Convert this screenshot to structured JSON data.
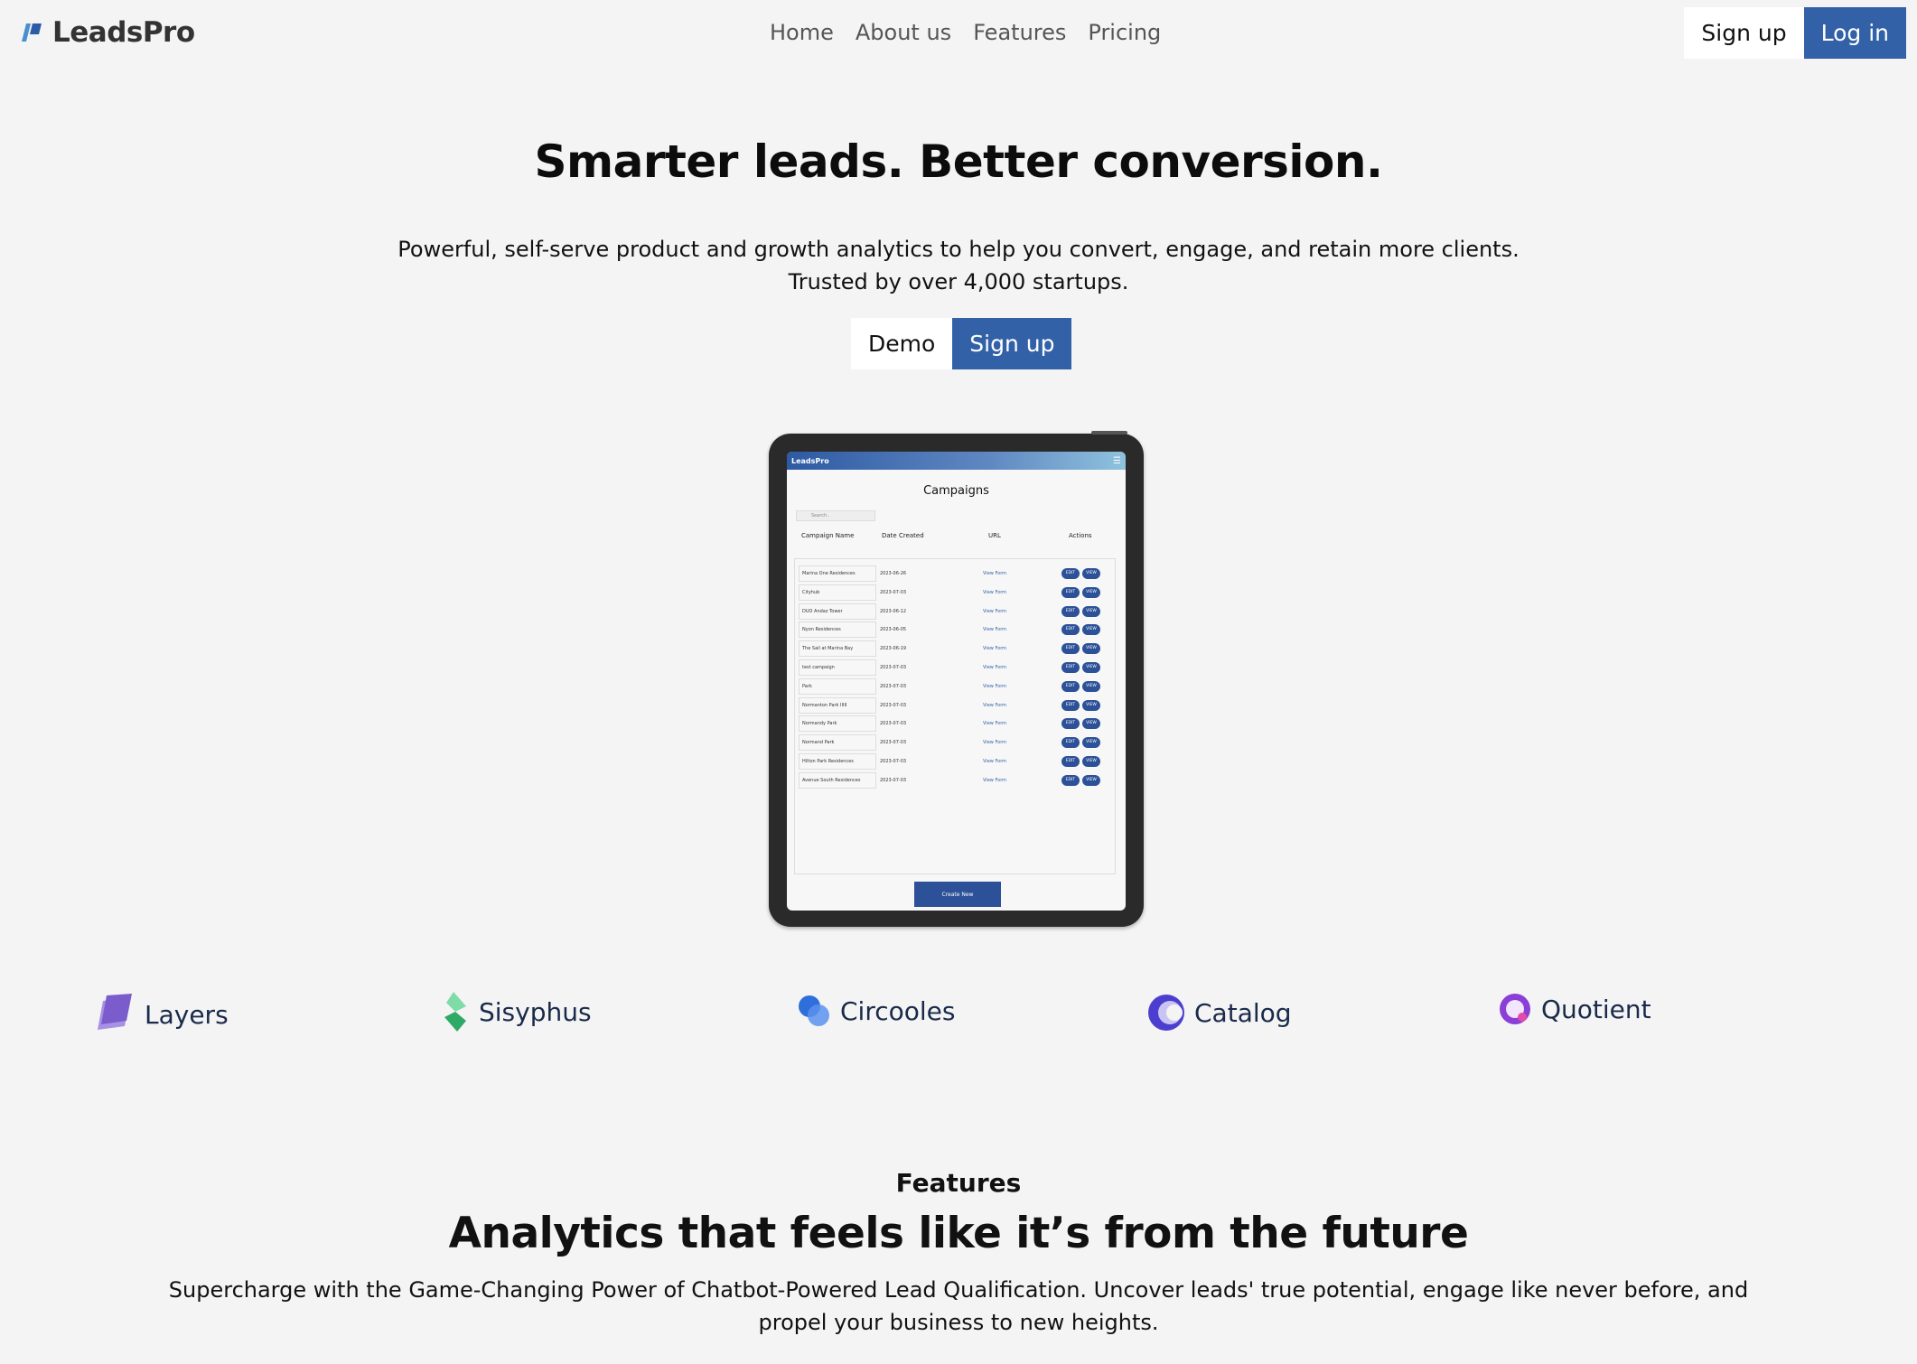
{
  "nav": {
    "brand": "LeadsPro",
    "links": [
      "Home",
      "About us",
      "Features",
      "Pricing"
    ],
    "signup_label": "Sign up",
    "login_label": "Log in"
  },
  "hero": {
    "title": "Smarter leads. Better conversion.",
    "subtitle_line1": "Powerful, self-serve product and growth analytics to help you convert, engage, and retain more clients.",
    "subtitle_line2": "Trusted by over 4,000 startups.",
    "demo_label": "Demo",
    "signup_label": "Sign up"
  },
  "preview": {
    "brand": "LeadsPro",
    "title": "Campaigns",
    "search_placeholder": "Search..",
    "columns": [
      "Campaign Name",
      "Date Created",
      "URL",
      "Actions"
    ],
    "rows": [
      {
        "name": "Marina One Residences",
        "date": "2023-06-26",
        "url": "View Form"
      },
      {
        "name": "Cityhub",
        "date": "2023-07-03",
        "url": "View Form"
      },
      {
        "name": "DUO Andaz Tower",
        "date": "2023-06-12",
        "url": "View Form"
      },
      {
        "name": "Nyon Residences",
        "date": "2023-06-05",
        "url": "View Form"
      },
      {
        "name": "The Sail at Marina Bay",
        "date": "2023-06-19",
        "url": "View Form"
      },
      {
        "name": "test campaign",
        "date": "2023-07-03",
        "url": "View Form"
      },
      {
        "name": "Park",
        "date": "2023-07-03",
        "url": "View Form"
      },
      {
        "name": "Normanton Park IIIII",
        "date": "2023-07-03",
        "url": "View Form"
      },
      {
        "name": "Normandy Park",
        "date": "2023-07-03",
        "url": "View Form"
      },
      {
        "name": "Normand Park",
        "date": "2023-07-03",
        "url": "View Form"
      },
      {
        "name": "Hilton Park Residences",
        "date": "2023-07-03",
        "url": "View Form"
      },
      {
        "name": "Avenue South Residences",
        "date": "2023-07-03",
        "url": "View Form"
      }
    ],
    "edit_label": "EDIT",
    "view_label": "VIEW",
    "create_label": "Create New"
  },
  "brands": [
    {
      "name": "Layers",
      "icon": "layers-icon",
      "color": "#7b5ccc"
    },
    {
      "name": "Sisyphus",
      "icon": "sisyphus-icon",
      "color": "#3fbf7a"
    },
    {
      "name": "Circooles",
      "icon": "circooles-icon",
      "color": "#2f6fdc"
    },
    {
      "name": "Catalog",
      "icon": "catalog-icon",
      "color": "#4c3fcf"
    },
    {
      "name": "Quotient",
      "icon": "quotient-icon",
      "color": "#8a3fd6"
    }
  ],
  "features": {
    "label": "Features",
    "title": "Analytics that feels like it’s from the future",
    "subtitle": "Supercharge with the Game-Changing Power of Chatbot-Powered Lead Qualification. Uncover leads' true potential, engage like never before, and propel your business to new heights."
  },
  "colors": {
    "primary": "#3261a8",
    "background": "#f4f4f4"
  }
}
